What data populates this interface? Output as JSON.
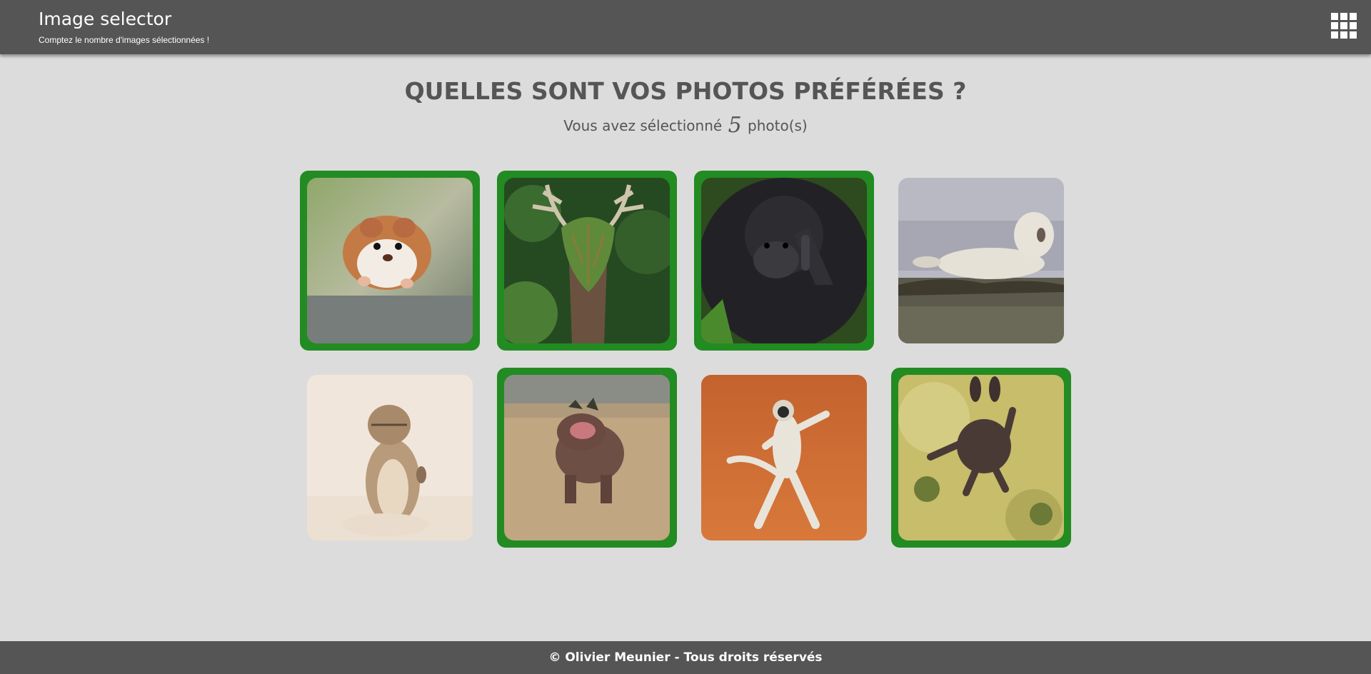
{
  "header": {
    "title": "Image selector",
    "subtitle": "Comptez le nombre d'images sélectionnées !",
    "menu_icon": "grid-icon"
  },
  "main": {
    "heading": "QUELLES SONT VOS PHOTOS PRÉFÉRÉES ?",
    "counter_prefix": "Vous avez sélectionné",
    "selected_count": "5",
    "counter_suffix": "photo(s)"
  },
  "photos": [
    {
      "subject": "hamster",
      "selected": true
    },
    {
      "subject": "deer",
      "selected": true
    },
    {
      "subject": "gorilla",
      "selected": true
    },
    {
      "subject": "seal",
      "selected": false
    },
    {
      "subject": "ground-squirrel",
      "selected": false
    },
    {
      "subject": "hippo",
      "selected": true
    },
    {
      "subject": "lemur",
      "selected": false
    },
    {
      "subject": "squirrel",
      "selected": true
    }
  ],
  "colors": {
    "selected_border": "#228b22",
    "bar_background": "#555555",
    "page_background": "#dcdcdc"
  },
  "footer": {
    "copyright": "© Olivier Meunier - Tous droits réservés"
  }
}
